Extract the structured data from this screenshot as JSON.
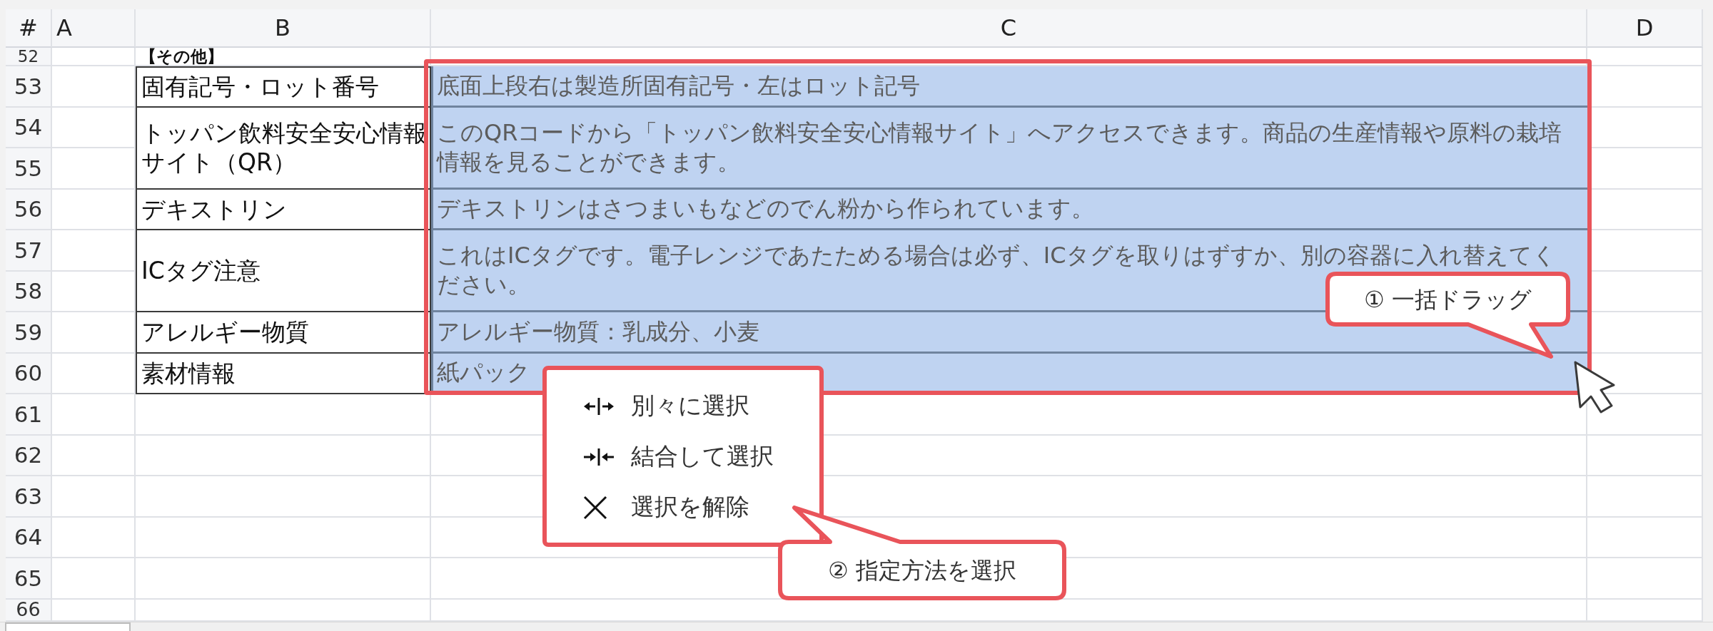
{
  "sheet": {
    "corner": "#",
    "column_headers": [
      "A",
      "B",
      "C",
      "D"
    ],
    "rows": [
      {
        "kind": "heading",
        "numbers": [
          "52"
        ],
        "label": "【その他】",
        "selected": false
      },
      {
        "kind": "entry",
        "numbers": [
          "53"
        ],
        "label": "固有記号・ロット番号",
        "value": "底面上段右は製造所固有記号・左はロット記号",
        "selected": true
      },
      {
        "kind": "entry",
        "numbers": [
          "54",
          "55"
        ],
        "label": "トッパン飲料安全安心情報サイト（QR）",
        "value": "このQRコードから「トッパン飲料安全安心情報サイト」へアクセスできます。商品の生産情報や原料の栽培情報を見ることができます。",
        "selected": true
      },
      {
        "kind": "entry",
        "numbers": [
          "56"
        ],
        "label": "デキストリン",
        "value": "デキストリンはさつまいもなどのでん粉から作られています。",
        "selected": true
      },
      {
        "kind": "entry",
        "numbers": [
          "57",
          "58"
        ],
        "label": "ICタグ注意",
        "value": "これはICタグです。電子レンジであたためる場合は必ず、ICタグを取りはずすか、別の容器に入れ替えてください。",
        "selected": true
      },
      {
        "kind": "entry",
        "numbers": [
          "59"
        ],
        "label": "アレルギー物質",
        "value": "アレルギー物質：乳成分、小麦",
        "selected": true
      },
      {
        "kind": "entry",
        "numbers": [
          "60"
        ],
        "label": "素材情報",
        "value": "紙パック",
        "selected": true
      },
      {
        "kind": "empty",
        "numbers": [
          "61"
        ],
        "selected": false
      },
      {
        "kind": "empty",
        "numbers": [
          "62"
        ],
        "selected": false
      },
      {
        "kind": "empty",
        "numbers": [
          "63"
        ],
        "selected": false
      },
      {
        "kind": "empty",
        "numbers": [
          "64"
        ],
        "selected": false
      },
      {
        "kind": "empty",
        "numbers": [
          "65"
        ],
        "selected": false
      },
      {
        "kind": "empty",
        "numbers": [
          "66"
        ],
        "selected": false
      }
    ]
  },
  "context_menu": {
    "items": [
      {
        "kind": "split",
        "label": "別々に選択"
      },
      {
        "kind": "merge",
        "label": "結合して選択"
      },
      {
        "kind": "clear",
        "label": "選択を解除"
      }
    ]
  },
  "callouts": [
    {
      "text": "① 一括ドラッグ"
    },
    {
      "text": "② 指定方法を選択"
    }
  ]
}
